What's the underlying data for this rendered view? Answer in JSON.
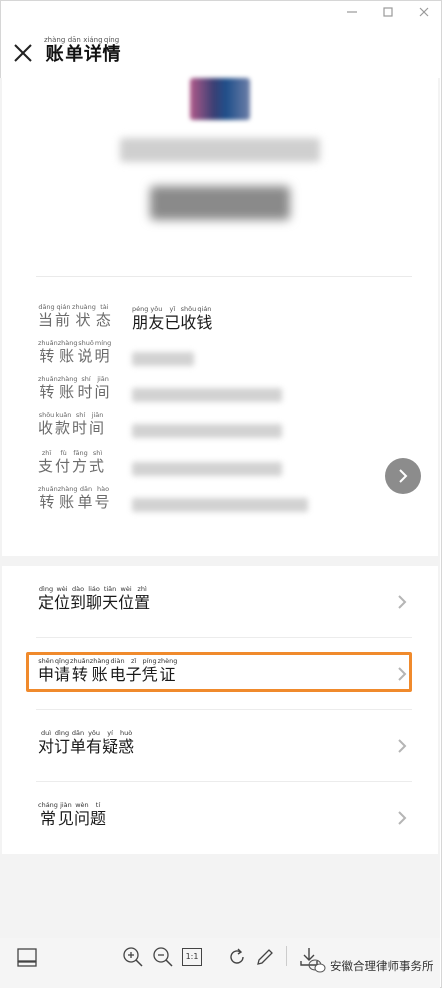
{
  "window": {
    "controls": [
      "minimize",
      "maximize",
      "close"
    ]
  },
  "header": {
    "title_chars": [
      {
        "char": "账",
        "pinyin": "zhàng"
      },
      {
        "char": "单",
        "pinyin": "dān"
      },
      {
        "char": "详",
        "pinyin": "xiáng"
      },
      {
        "char": "情",
        "pinyin": "qíng"
      }
    ],
    "close_icon": "close-icon"
  },
  "details": [
    {
      "label": [
        {
          "char": "当",
          "pinyin": "dāng"
        },
        {
          "char": "前",
          "pinyin": "qián"
        },
        {
          "char": "状",
          "pinyin": "zhuàng"
        },
        {
          "char": "态",
          "pinyin": "tài"
        }
      ],
      "value": [
        {
          "char": "朋",
          "pinyin": "péng"
        },
        {
          "char": "友",
          "pinyin": "yǒu"
        },
        {
          "char": "已",
          "pinyin": "yǐ"
        },
        {
          "char": "收",
          "pinyin": "shōu"
        },
        {
          "char": "钱",
          "pinyin": "qián"
        }
      ]
    },
    {
      "label": [
        {
          "char": "转",
          "pinyin": "zhuǎn"
        },
        {
          "char": "账",
          "pinyin": "zhàng"
        },
        {
          "char": "说",
          "pinyin": "shuō"
        },
        {
          "char": "明",
          "pinyin": "míng"
        }
      ]
    },
    {
      "label": [
        {
          "char": "转",
          "pinyin": "zhuǎn"
        },
        {
          "char": "账",
          "pinyin": "zhàng"
        },
        {
          "char": "时",
          "pinyin": "shí"
        },
        {
          "char": "间",
          "pinyin": "jiān"
        }
      ]
    },
    {
      "label": [
        {
          "char": "收",
          "pinyin": "shōu"
        },
        {
          "char": "款",
          "pinyin": "kuǎn"
        },
        {
          "char": "时",
          "pinyin": "shí"
        },
        {
          "char": "间",
          "pinyin": "jiān"
        }
      ]
    },
    {
      "label": [
        {
          "char": "支",
          "pinyin": "zhī"
        },
        {
          "char": "付",
          "pinyin": "fù"
        },
        {
          "char": "方",
          "pinyin": "fāng"
        },
        {
          "char": "式",
          "pinyin": "shì"
        }
      ]
    },
    {
      "label": [
        {
          "char": "转",
          "pinyin": "zhuǎn"
        },
        {
          "char": "账",
          "pinyin": "zhàng"
        },
        {
          "char": "单",
          "pinyin": "dān"
        },
        {
          "char": "号",
          "pinyin": "hào"
        }
      ]
    }
  ],
  "menu": [
    {
      "chars": [
        {
          "char": "定",
          "pinyin": "dìng"
        },
        {
          "char": "位",
          "pinyin": "wèi"
        },
        {
          "char": "到",
          "pinyin": "dào"
        },
        {
          "char": "聊",
          "pinyin": "liáo"
        },
        {
          "char": "天",
          "pinyin": "tiān"
        },
        {
          "char": "位",
          "pinyin": "wèi"
        },
        {
          "char": "置",
          "pinyin": "zhì"
        }
      ]
    },
    {
      "chars": [
        {
          "char": "申",
          "pinyin": "shēn"
        },
        {
          "char": "请",
          "pinyin": "qǐng"
        },
        {
          "char": "转",
          "pinyin": "zhuǎn"
        },
        {
          "char": "账",
          "pinyin": "zhàng"
        },
        {
          "char": "电",
          "pinyin": "diàn"
        },
        {
          "char": "子",
          "pinyin": "zǐ"
        },
        {
          "char": "凭",
          "pinyin": "píng"
        },
        {
          "char": "证",
          "pinyin": "zhèng"
        }
      ]
    },
    {
      "chars": [
        {
          "char": "对",
          "pinyin": "duì"
        },
        {
          "char": "订",
          "pinyin": "dìng"
        },
        {
          "char": "单",
          "pinyin": "dān"
        },
        {
          "char": "有",
          "pinyin": "yǒu"
        },
        {
          "char": "疑",
          "pinyin": "yí"
        },
        {
          "char": "惑",
          "pinyin": "huò"
        }
      ]
    },
    {
      "chars": [
        {
          "char": "常",
          "pinyin": "cháng"
        },
        {
          "char": "见",
          "pinyin": "jiàn"
        },
        {
          "char": "问",
          "pinyin": "wèn"
        },
        {
          "char": "题",
          "pinyin": "tí"
        }
      ]
    }
  ],
  "highlight_color": "#f08a2c",
  "toolbar": {
    "zoom_reset_label": "1:1",
    "icons": [
      "panel-icon",
      "zoom-in-icon",
      "zoom-out-icon",
      "actual-size-icon",
      "rotate-icon",
      "edit-icon",
      "download-icon"
    ]
  },
  "watermark": {
    "text": "安徽合理律师事务所",
    "icon": "wechat-icon"
  }
}
